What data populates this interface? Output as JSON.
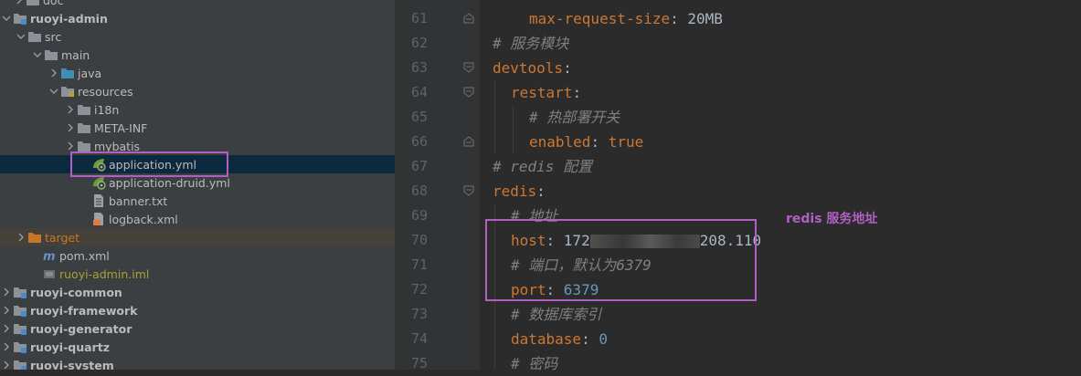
{
  "tree": {
    "items": [
      {
        "label": "doc",
        "icon": "folder-icon",
        "expanded": false
      },
      {
        "label": "ruoyi-admin",
        "icon": "module-folder-icon",
        "expanded": true
      },
      {
        "label": "src",
        "icon": "folder-icon",
        "expanded": true
      },
      {
        "label": "main",
        "icon": "folder-icon",
        "expanded": true
      },
      {
        "label": "java",
        "icon": "source-folder-icon",
        "expanded": false
      },
      {
        "label": "resources",
        "icon": "resources-folder-icon",
        "expanded": true
      },
      {
        "label": "i18n",
        "icon": "folder-icon",
        "expanded": false
      },
      {
        "label": "META-INF",
        "icon": "folder-icon",
        "expanded": false
      },
      {
        "label": "mybatis",
        "icon": "folder-icon",
        "expanded": false
      },
      {
        "label": "application.yml",
        "icon": "spring-yaml-icon",
        "selected": true
      },
      {
        "label": "application-druid.yml",
        "icon": "spring-yaml-icon"
      },
      {
        "label": "banner.txt",
        "icon": "text-file-icon"
      },
      {
        "label": "logback.xml",
        "icon": "xml-file-icon"
      },
      {
        "label": "target",
        "icon": "excluded-folder-icon",
        "expanded": false
      },
      {
        "label": "pom.xml",
        "icon": "maven-icon"
      },
      {
        "label": "ruoyi-admin.iml",
        "icon": "iml-file-icon"
      },
      {
        "label": "ruoyi-common",
        "icon": "module-folder-icon",
        "expanded": false
      },
      {
        "label": "ruoyi-framework",
        "icon": "module-folder-icon",
        "expanded": false
      },
      {
        "label": "ruoyi-generator",
        "icon": "module-folder-icon",
        "expanded": false
      },
      {
        "label": "ruoyi-quartz",
        "icon": "module-folder-icon",
        "expanded": false
      },
      {
        "label": "ruoyi-system",
        "icon": "module-folder-icon",
        "expanded": false
      }
    ]
  },
  "editor": {
    "line_numbers": [
      "61",
      "62",
      "63",
      "64",
      "65",
      "66",
      "67",
      "68",
      "69",
      "70",
      "71",
      "72",
      "73",
      "74",
      "75"
    ],
    "lines": {
      "l61": {
        "key": "max-request-size",
        "sep": ": ",
        "value": "20MB"
      },
      "l62": {
        "comment": "# 服务模块"
      },
      "l63": {
        "key": "devtools",
        "sep": ":"
      },
      "l64": {
        "key": "restart",
        "sep": ":"
      },
      "l65": {
        "comment": "# 热部署开关"
      },
      "l66": {
        "key": "enabled",
        "sep": ": ",
        "value": "true"
      },
      "l67": {
        "comment": "# redis 配置"
      },
      "l68": {
        "key": "redis",
        "sep": ":"
      },
      "l69": {
        "comment": "# 地址"
      },
      "l70": {
        "key": "host",
        "sep": ": ",
        "value_prefix": "172",
        "value_suffix": "208.110"
      },
      "l71": {
        "comment": "# 端口，默认为6379"
      },
      "l72": {
        "key": "port",
        "sep": ": ",
        "value": "6379"
      },
      "l73": {
        "comment": "# 数据库索引"
      },
      "l74": {
        "key": "database",
        "sep": ": ",
        "value": "0"
      },
      "l75": {
        "comment": "# 密码"
      }
    }
  },
  "annotation": {
    "text": "redis 服务地址"
  },
  "colors": {
    "highlight": "#b05fc5",
    "keyword": "#cc7832",
    "comment": "#808080",
    "number": "#6897bb",
    "selection": "#0d293e"
  }
}
